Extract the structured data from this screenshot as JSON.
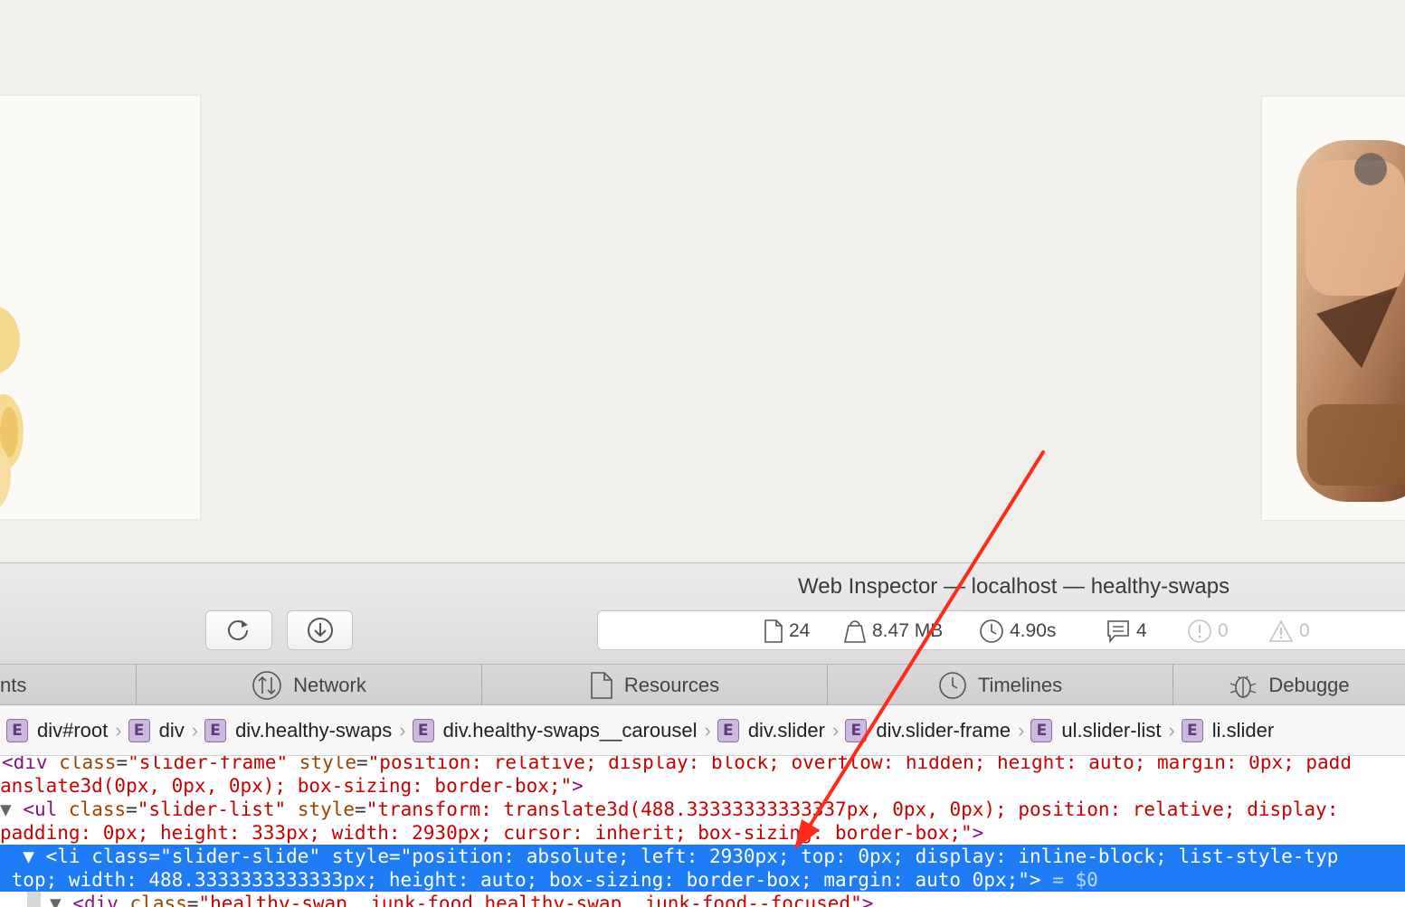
{
  "window": {
    "title": "Web Inspector — localhost — healthy-swaps"
  },
  "toolbar": {
    "reload_icon": "reload-icon",
    "download_icon": "download-icon"
  },
  "stats": {
    "resources": "24",
    "size": "8.47 MB",
    "time": "4.90s",
    "logs": "4",
    "errors": "0",
    "warnings": "0"
  },
  "tabs": [
    {
      "label": "nts",
      "icon": ""
    },
    {
      "label": "Network",
      "icon": "network-icon"
    },
    {
      "label": "Resources",
      "icon": "document-icon"
    },
    {
      "label": "Timelines",
      "icon": "clock-icon"
    },
    {
      "label": "Debugge",
      "icon": "bug-icon"
    }
  ],
  "breadcrumb": [
    "div#root",
    "div",
    "div.healthy-swaps",
    "div.healthy-swaps__carousel",
    "div.slider",
    "div.slider-frame",
    "ul.slider-list",
    "li.slider"
  ],
  "breadcrumb_badge": "E",
  "dom": {
    "line1": {
      "tag": "<div",
      "attr1": "class",
      "val1": "\"slider-frame\"",
      "attr2": "style",
      "val2": "\"position: relative; display: block; overflow: hidden; height: auto; margin: 0px; padd"
    },
    "line2": {
      "text": "anslate3d(0px, 0px, 0px); box-sizing: border-box;\"",
      "close": ">"
    },
    "line3": {
      "tag": "<ul",
      "attr1": "class",
      "val1": "\"slider-list\"",
      "attr2": "style",
      "val2": "\"transform: translate3d(488.33333333333337px, 0px, 0px); position: relative; display: "
    },
    "line4": {
      "text": "padding: 0px; height: 333px; width: 2930px; cursor: inherit; box-sizing: border-box;\"",
      "close": ">"
    },
    "line5": {
      "tag": "<li",
      "attr1": "class",
      "val1": "\"slider-slide\"",
      "attr2": "style",
      "val2": "\"position: absolute; left: 2930px; top: 0px; display: inline-block; list-style-typ"
    },
    "line6": {
      "text": "top; width: 488.3333333333333px; height: auto; box-sizing: border-box; margin: auto 0px;\"",
      "close": ">",
      "ref": " = $0"
    },
    "line7": {
      "tag": "<div",
      "attr1": "class",
      "val1": "\"healthy-swap__junk-food healthy-swap__junk-food--focused\"",
      "close": ">"
    }
  },
  "colors": {
    "selection": "#1f7cf7",
    "arrow": "#ff2a1a",
    "badge": "#cdb8de"
  }
}
